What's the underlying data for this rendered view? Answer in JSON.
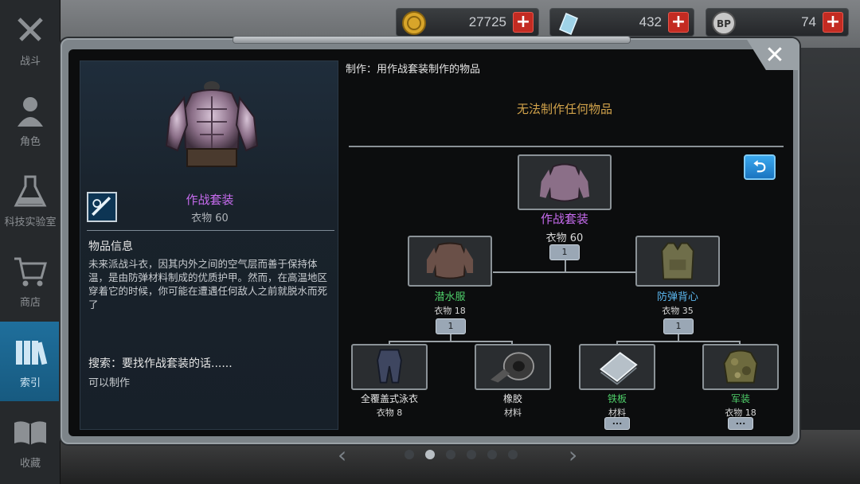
{
  "sidebar": {
    "items": [
      {
        "label": "战斗",
        "icon": "crossed-swords-icon",
        "active": false
      },
      {
        "label": "角色",
        "icon": "character-icon",
        "active": false
      },
      {
        "label": "科技实验室",
        "icon": "flask-icon",
        "active": false
      },
      {
        "label": "商店",
        "icon": "cart-icon",
        "active": false
      },
      {
        "label": "索引",
        "icon": "books-icon",
        "active": true
      },
      {
        "label": "收藏",
        "icon": "open-book-icon",
        "active": false
      }
    ]
  },
  "currency": {
    "coins": {
      "value": "27725",
      "icon": "coin-icon",
      "add": "+"
    },
    "crystals": {
      "value": "432",
      "icon": "crystal-icon",
      "add": "+"
    },
    "bp": {
      "value": "74",
      "icon": "bp-badge-icon",
      "icon_text": "BP",
      "add": "+"
    }
  },
  "dialog": {
    "close": "✕",
    "info": {
      "item_name": "作战套装",
      "item_type": "衣物 60",
      "info_title": "物品信息",
      "description": "未来派战斗衣，因其内外之间的空气层而善于保持体温，是由防弹材料制成的优质护甲。然而，在高温地区穿着它的时候，你可能在遭遇任何敌人之前就脱水而死了",
      "search_title": "搜索：要找作战套装的话......",
      "search_status": "可以制作"
    },
    "craft": {
      "header": "制作：用作战套装制作的物品",
      "none_message": "无法制作任何物品",
      "back": "⮌"
    },
    "tree": {
      "root": {
        "name": "作战套装",
        "sub": "衣物 60",
        "qty": "1",
        "color": "#c86cf0"
      },
      "left": {
        "name": "潜水服",
        "sub": "衣物 18",
        "qty": "1",
        "color": "#4fd06a"
      },
      "right": {
        "name": "防弹背心",
        "sub": "衣物 35",
        "qty": "1",
        "color": "#5cb8f0"
      },
      "leaves": [
        {
          "name": "全覆盖式泳衣",
          "sub": "衣物 8",
          "color": "#e6e6e6",
          "more": ""
        },
        {
          "name": "橡胶",
          "sub": "材料",
          "color": "#e6e6e6",
          "more": ""
        },
        {
          "name": "铁板",
          "sub": "材料",
          "color": "#4fd06a",
          "more": "..."
        },
        {
          "name": "军装",
          "sub": "衣物 18",
          "color": "#4fd06a",
          "more": "..."
        }
      ]
    }
  },
  "pager": {
    "prev": "‹",
    "next": "›",
    "pages": 6,
    "current": 2
  }
}
